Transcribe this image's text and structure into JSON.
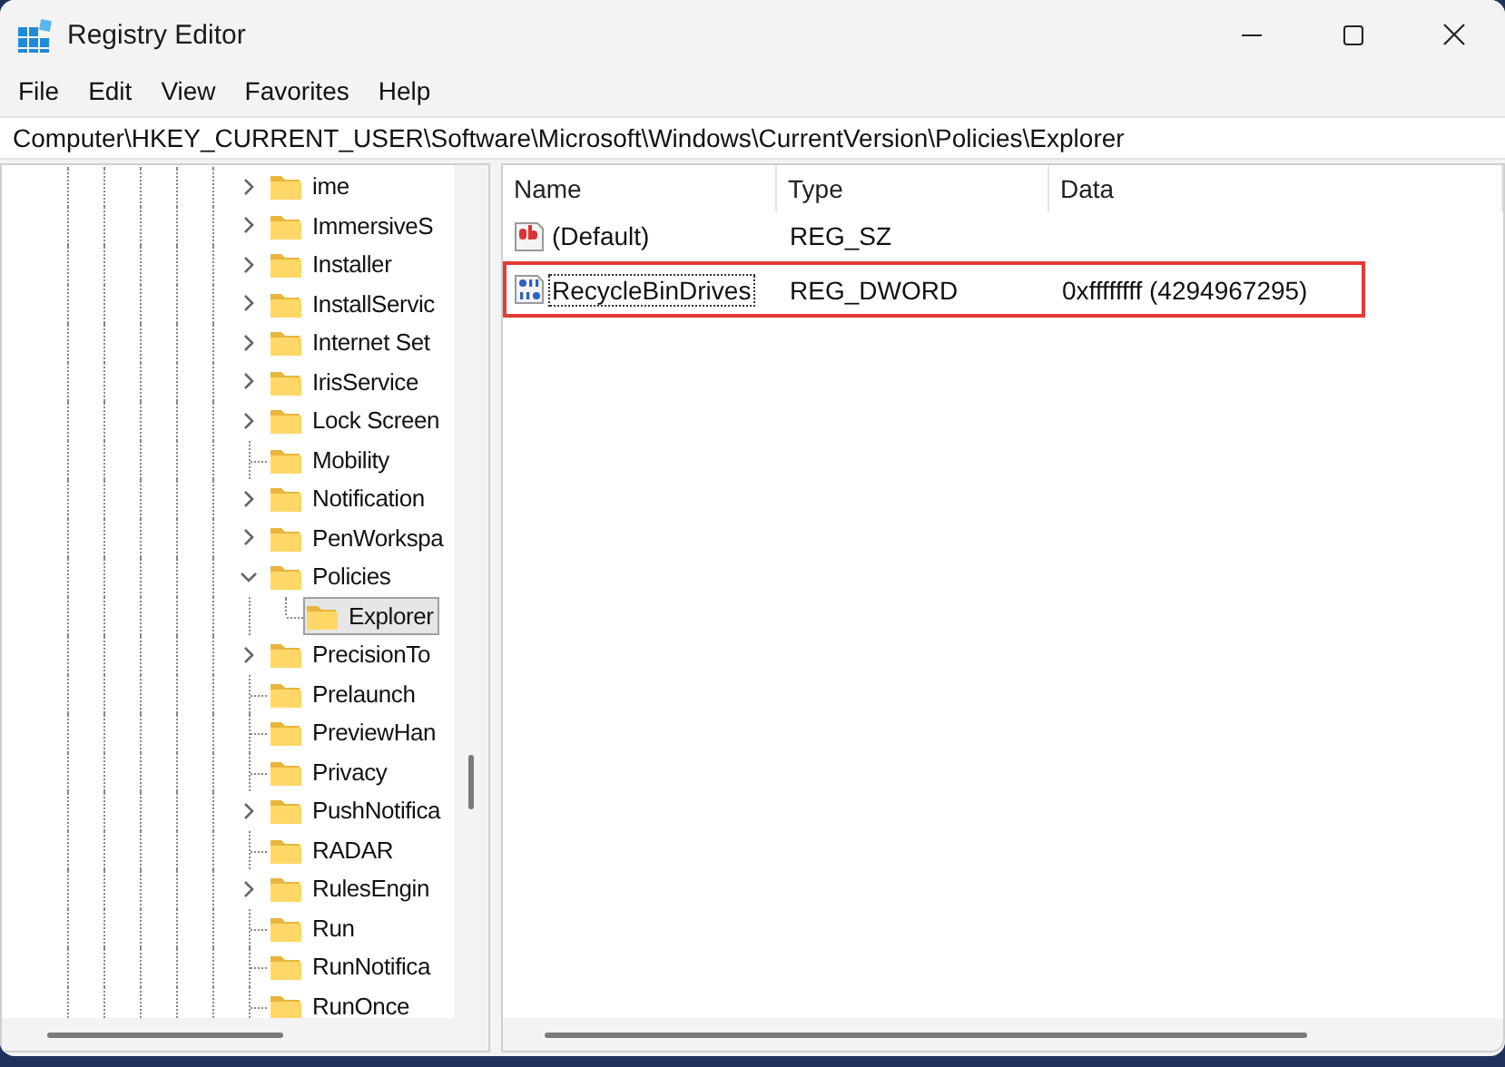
{
  "window": {
    "title": "Registry Editor"
  },
  "menu": [
    "File",
    "Edit",
    "View",
    "Favorites",
    "Help"
  ],
  "address": "Computer\\HKEY_CURRENT_USER\\Software\\Microsoft\\Windows\\CurrentVersion\\Policies\\Explorer",
  "tree": [
    {
      "label": "ime",
      "expandable": true,
      "expanded": false,
      "selected": false
    },
    {
      "label": "ImmersiveS",
      "expandable": true,
      "expanded": false,
      "selected": false
    },
    {
      "label": "Installer",
      "expandable": true,
      "expanded": false,
      "selected": false
    },
    {
      "label": "InstallServic",
      "expandable": true,
      "expanded": false,
      "selected": false
    },
    {
      "label": "Internet Set",
      "expandable": true,
      "expanded": false,
      "selected": false
    },
    {
      "label": "IrisService",
      "expandable": true,
      "expanded": false,
      "selected": false
    },
    {
      "label": "Lock Screen",
      "expandable": true,
      "expanded": false,
      "selected": false
    },
    {
      "label": "Mobility",
      "expandable": false,
      "selected": false
    },
    {
      "label": "Notification",
      "expandable": true,
      "expanded": false,
      "selected": false
    },
    {
      "label": "PenWorkspa",
      "expandable": true,
      "expanded": false,
      "selected": false
    },
    {
      "label": "Policies",
      "expandable": true,
      "expanded": true,
      "selected": false,
      "children": [
        {
          "label": "Explorer",
          "expandable": false,
          "selected": true
        }
      ]
    },
    {
      "label": "PrecisionTo",
      "expandable": true,
      "expanded": false,
      "selected": false
    },
    {
      "label": "Prelaunch",
      "expandable": false,
      "selected": false
    },
    {
      "label": "PreviewHan",
      "expandable": false,
      "selected": false
    },
    {
      "label": "Privacy",
      "expandable": false,
      "selected": false
    },
    {
      "label": "PushNotifica",
      "expandable": true,
      "expanded": false,
      "selected": false
    },
    {
      "label": "RADAR",
      "expandable": false,
      "selected": false
    },
    {
      "label": "RulesEngin",
      "expandable": true,
      "expanded": false,
      "selected": false
    },
    {
      "label": "Run",
      "expandable": false,
      "selected": false
    },
    {
      "label": "RunNotifica",
      "expandable": false,
      "selected": false
    },
    {
      "label": "RunOnce",
      "expandable": false,
      "selected": false
    }
  ],
  "values": {
    "columns": [
      "Name",
      "Type",
      "Data"
    ],
    "rows": [
      {
        "kind": "string",
        "name": "(Default)",
        "type": "REG_SZ",
        "focused": false,
        "highlighted": false
      },
      {
        "kind": "dword",
        "name": "RecycleBinDrives",
        "type": "REG_DWORD",
        "data": "0xffffffff (4294967295)",
        "focused": true,
        "highlighted": true
      }
    ]
  }
}
